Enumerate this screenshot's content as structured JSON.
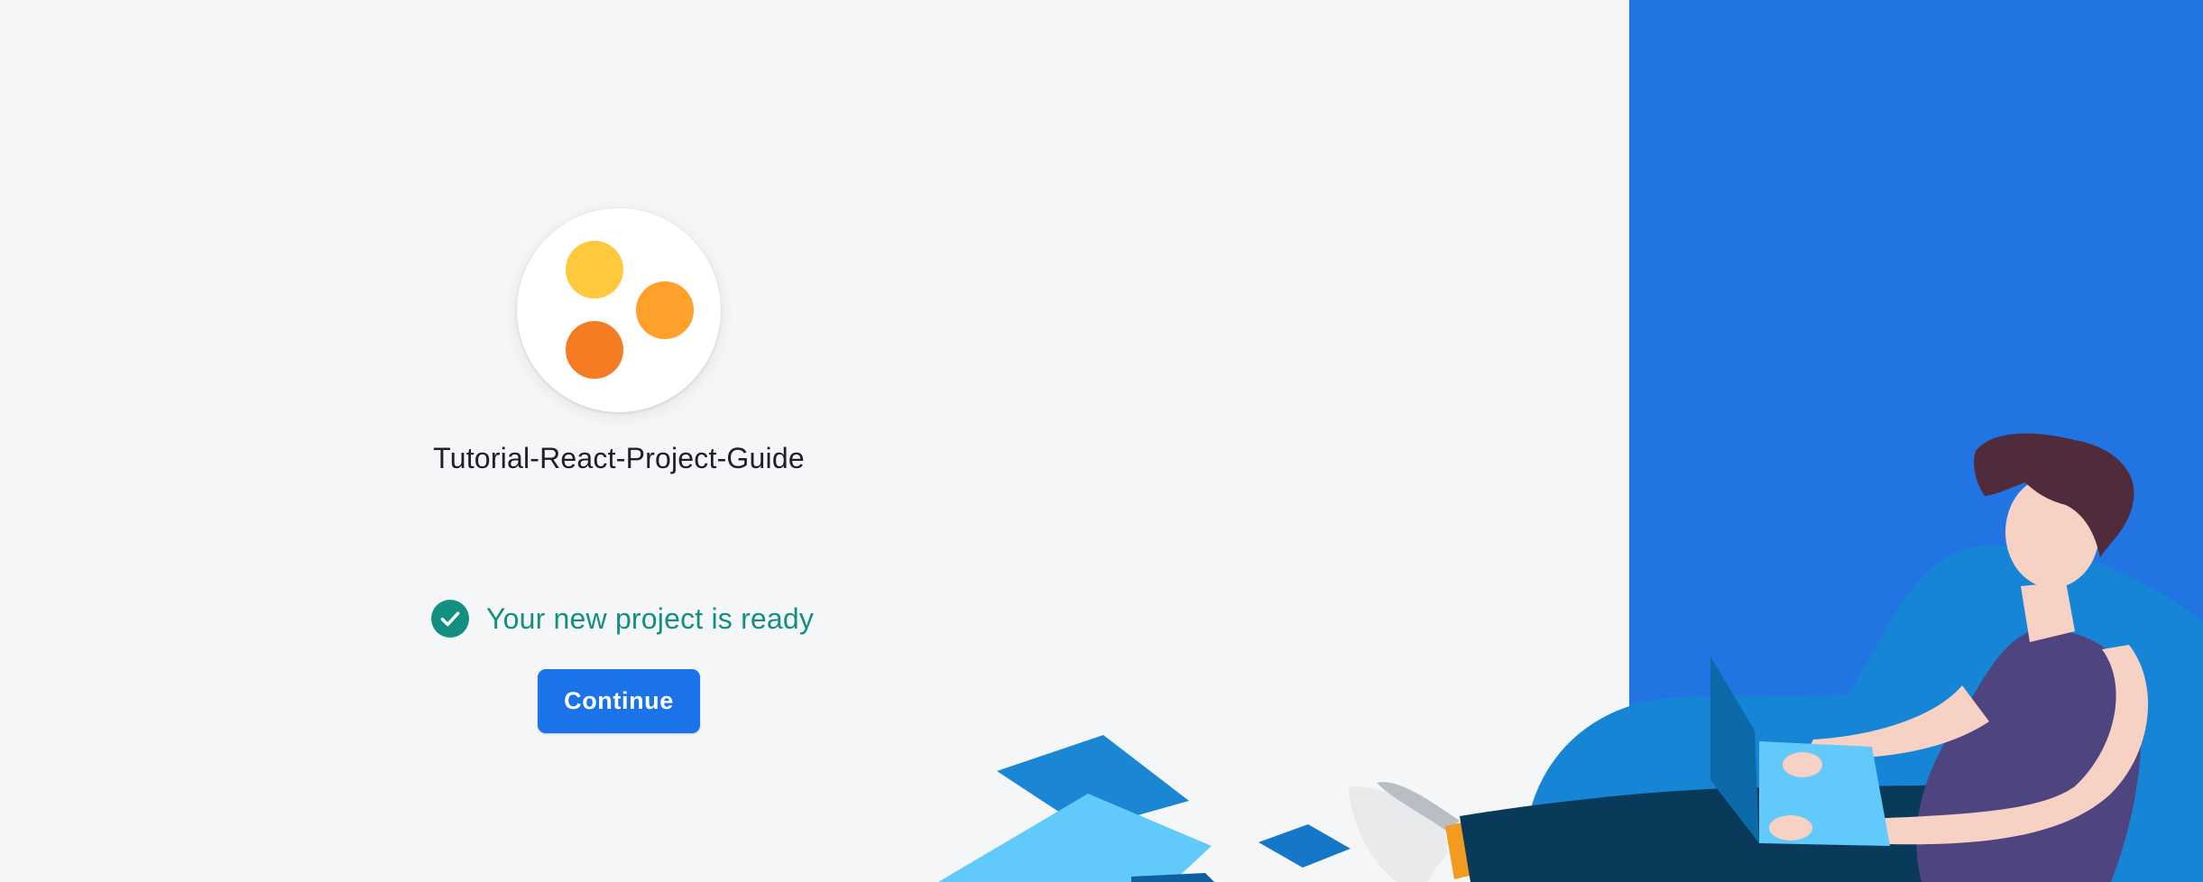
{
  "project": {
    "name": "Tutorial-React-Project-Guide",
    "logo_colors": [
      "#ffc83d",
      "#ffa02b",
      "#f57c22"
    ]
  },
  "status": {
    "text": "Your new project is ready",
    "icon": "check-circle-icon",
    "color": "#138f80"
  },
  "actions": {
    "continue_label": "Continue"
  },
  "theme": {
    "accent": "#1a73e8",
    "panel_blue": "#2274e3",
    "background": "#f5f6f8"
  }
}
